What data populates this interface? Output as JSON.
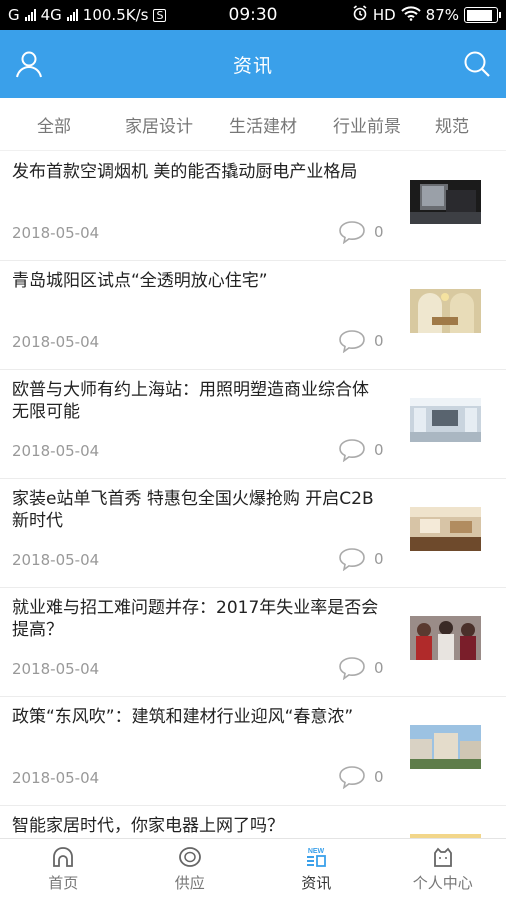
{
  "status_bar": {
    "carrier1": "G",
    "carrier2": "4G",
    "speed": "100.5K/s",
    "speed_badge": "S",
    "time": "09:30",
    "hd": "HD",
    "battery": "87%",
    "battery_level": 0.87
  },
  "header": {
    "title": "资讯",
    "icons": {
      "left": "user-icon",
      "right": "search-icon"
    }
  },
  "tabs": [
    {
      "label": "全部"
    },
    {
      "label": "家居设计"
    },
    {
      "label": "生活建材"
    },
    {
      "label": "行业前景"
    },
    {
      "label": "规范"
    }
  ],
  "news": [
    {
      "title": "发布首款空调烟机 美的能否撬动厨电产业格局",
      "date": "2018-05-04",
      "comments": "0"
    },
    {
      "title": "青岛城阳区试点“全透明放心住宅”",
      "date": "2018-05-04",
      "comments": "0"
    },
    {
      "title": "欧普与大师有约上海站：用照明塑造商业综合体无限可能",
      "date": "2018-05-04",
      "comments": "0"
    },
    {
      "title": "家装e站单飞首秀 特惠包全国火爆抢购 开启C2B新时代",
      "date": "2018-05-04",
      "comments": "0"
    },
    {
      "title": "就业难与招工难问题并存：2017年失业率是否会提高？",
      "date": "2018-05-04",
      "comments": "0"
    },
    {
      "title": "政策“东风吹”：建筑和建材行业迎风“春意浓”",
      "date": "2018-05-04",
      "comments": "0"
    },
    {
      "title": "智能家居时代，你家电器上网了吗？",
      "date": "",
      "comments": ""
    }
  ],
  "bottom_nav": [
    {
      "label": "首页",
      "icon": "home-icon"
    },
    {
      "label": "供应",
      "icon": "supply-icon"
    },
    {
      "label": "资讯",
      "icon": "news-icon",
      "badge": "NEW"
    },
    {
      "label": "个人中心",
      "icon": "profile-icon"
    }
  ],
  "colors": {
    "accent": "#3aa0ea",
    "text": "#222222",
    "muted": "#999999"
  }
}
